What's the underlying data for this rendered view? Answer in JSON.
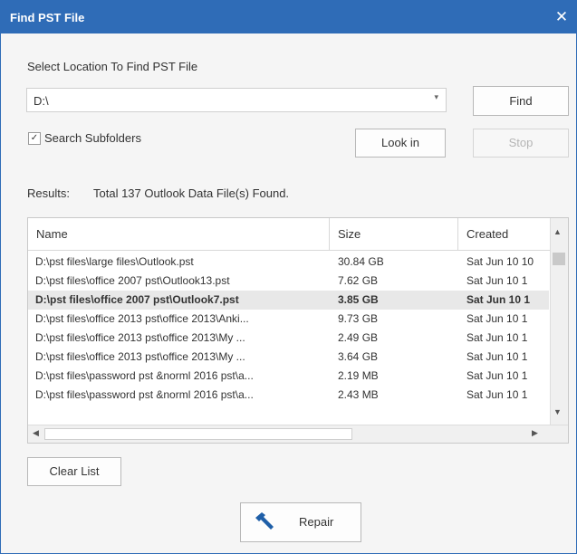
{
  "window": {
    "title": "Find PST File",
    "close_glyph": "✕"
  },
  "location": {
    "label": "Select Location To Find PST File",
    "value": "D:\\",
    "dropdown_glyph": "▾"
  },
  "buttons": {
    "find": "Find",
    "look_in": "Look in",
    "stop": "Stop",
    "clear_list": "Clear List",
    "repair": "Repair"
  },
  "options": {
    "search_subfolders_label": "Search Subfolders",
    "search_subfolders_checked": true,
    "check_glyph": "✓"
  },
  "results": {
    "label": "Results:",
    "summary": "Total 137 Outlook Data File(s) Found."
  },
  "table": {
    "columns": [
      "Name",
      "Size",
      "Created"
    ],
    "rows": [
      {
        "name": "D:\\pst files\\large files\\Outlook.pst",
        "size": "30.84 GB",
        "created": "Sat Jun 10 10",
        "selected": false
      },
      {
        "name": "D:\\pst files\\office 2007 pst\\Outlook13.pst",
        "size": "7.62 GB",
        "created": "Sat Jun 10 1",
        "selected": false
      },
      {
        "name": "D:\\pst files\\office 2007 pst\\Outlook7.pst",
        "size": "3.85 GB",
        "created": "Sat Jun 10 1",
        "selected": true
      },
      {
        "name": "D:\\pst files\\office 2013 pst\\office 2013\\Anki...",
        "size": "9.73 GB",
        "created": "Sat Jun 10 1",
        "selected": false
      },
      {
        "name": "D:\\pst files\\office 2013 pst\\office 2013\\My ...",
        "size": "2.49 GB",
        "created": "Sat Jun 10 1",
        "selected": false
      },
      {
        "name": "D:\\pst files\\office 2013 pst\\office 2013\\My ...",
        "size": "3.64 GB",
        "created": "Sat Jun 10 1",
        "selected": false
      },
      {
        "name": "D:\\pst files\\password pst &norml 2016 pst\\a...",
        "size": "2.19 MB",
        "created": "Sat Jun 10 1",
        "selected": false
      },
      {
        "name": "D:\\pst files\\password pst &norml 2016 pst\\a...",
        "size": "2.43 MB",
        "created": "Sat Jun 10 1",
        "selected": false
      }
    ]
  },
  "scroll_glyphs": {
    "up": "▲",
    "down": "▼",
    "left": "◀",
    "right": "▶"
  },
  "icons": {
    "repair": "hammer-icon"
  },
  "colors": {
    "title_bar": "#2f6cb7",
    "selected_row": "#e8e8e8",
    "icon": "#1f5fa8"
  }
}
